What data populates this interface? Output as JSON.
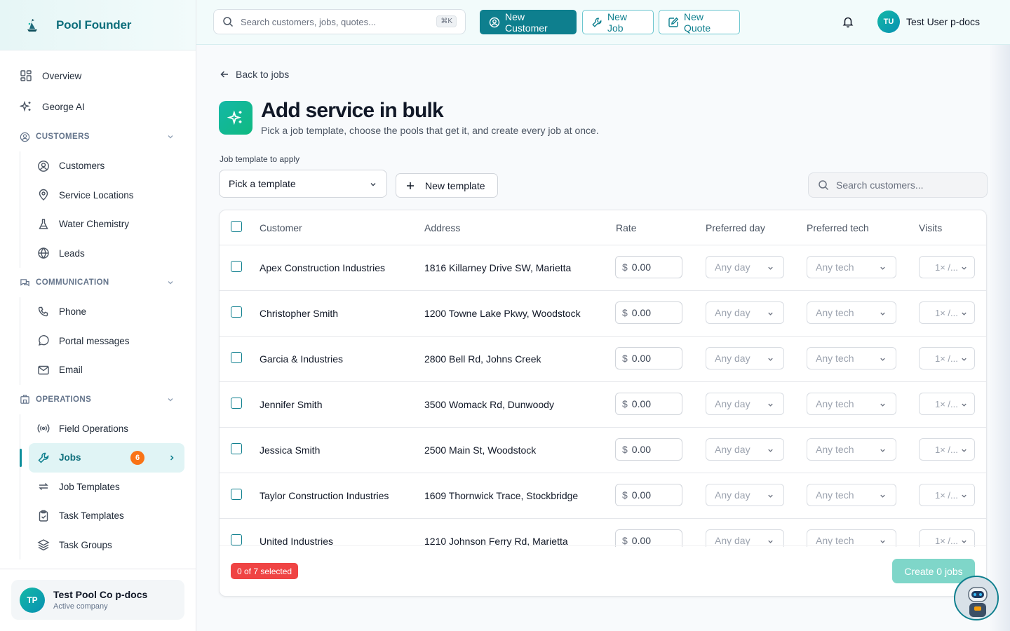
{
  "brand": {
    "name": "Pool Founder"
  },
  "sidebar": {
    "top_items": [
      {
        "label": "Overview"
      },
      {
        "label": "George AI"
      }
    ],
    "sections": [
      {
        "title": "CUSTOMERS",
        "items": [
          {
            "label": "Customers"
          },
          {
            "label": "Service Locations"
          },
          {
            "label": "Water Chemistry"
          },
          {
            "label": "Leads"
          }
        ]
      },
      {
        "title": "COMMUNICATION",
        "items": [
          {
            "label": "Phone"
          },
          {
            "label": "Portal messages"
          },
          {
            "label": "Email"
          }
        ]
      },
      {
        "title": "OPERATIONS",
        "items": [
          {
            "label": "Field Operations"
          },
          {
            "label": "Jobs",
            "badge": "6"
          },
          {
            "label": "Job Templates"
          },
          {
            "label": "Task Templates"
          },
          {
            "label": "Task Groups"
          }
        ]
      }
    ],
    "company": {
      "initials": "TP",
      "name": "Test Pool Co p-docs",
      "subtitle": "Active company"
    }
  },
  "topbar": {
    "search_placeholder": "Search customers, jobs, quotes...",
    "search_shortcut": "⌘K",
    "new_customer": "New Customer",
    "new_job": "New Job",
    "new_quote": "New Quote",
    "user": {
      "initials": "TU",
      "name": "Test User p-docs"
    }
  },
  "page": {
    "back_label": "Back to jobs",
    "title": "Add service in bulk",
    "subtitle": "Pick a job template, choose the pools that get it, and create every job at once.",
    "template_label": "Job template to apply",
    "template_value": "Pick a template",
    "new_template": "New template",
    "search_placeholder": "Search customers..."
  },
  "table": {
    "headers": {
      "customer": "Customer",
      "address": "Address",
      "rate": "Rate",
      "day": "Preferred day",
      "tech": "Preferred tech",
      "visits": "Visits"
    },
    "rows": [
      {
        "customer": "Apex Construction Industries",
        "address": "1816 Killarney Drive SW, Marietta",
        "currency": "$",
        "rate": "0.00",
        "day": "Any day",
        "tech": "Any tech",
        "visits": "1× /..."
      },
      {
        "customer": "Christopher Smith",
        "address": "1200 Towne Lake Pkwy, Woodstock",
        "currency": "$",
        "rate": "0.00",
        "day": "Any day",
        "tech": "Any tech",
        "visits": "1× /..."
      },
      {
        "customer": "Garcia & Industries",
        "address": "2800 Bell Rd, Johns Creek",
        "currency": "$",
        "rate": "0.00",
        "day": "Any day",
        "tech": "Any tech",
        "visits": "1× /..."
      },
      {
        "customer": "Jennifer Smith",
        "address": "3500 Womack Rd, Dunwoody",
        "currency": "$",
        "rate": "0.00",
        "day": "Any day",
        "tech": "Any tech",
        "visits": "1× /..."
      },
      {
        "customer": "Jessica Smith",
        "address": "2500 Main St, Woodstock",
        "currency": "$",
        "rate": "0.00",
        "day": "Any day",
        "tech": "Any tech",
        "visits": "1× /..."
      },
      {
        "customer": "Taylor Construction Industries",
        "address": "1609 Thornwick Trace, Stockbridge",
        "currency": "$",
        "rate": "0.00",
        "day": "Any day",
        "tech": "Any tech",
        "visits": "1× /..."
      },
      {
        "customer": "United Industries",
        "address": "1210 Johnson Ferry Rd, Marietta",
        "currency": "$",
        "rate": "0.00",
        "day": "Any day",
        "tech": "Any tech",
        "visits": "1× /..."
      }
    ],
    "selected_text": "0 of 7 selected",
    "create_label": "Create 0 jobs"
  },
  "colors": {
    "accent": "#0e7f8e",
    "badge": "#f97316",
    "selected_badge": "#ef4444",
    "create_disabled": "#7fd6c9"
  }
}
